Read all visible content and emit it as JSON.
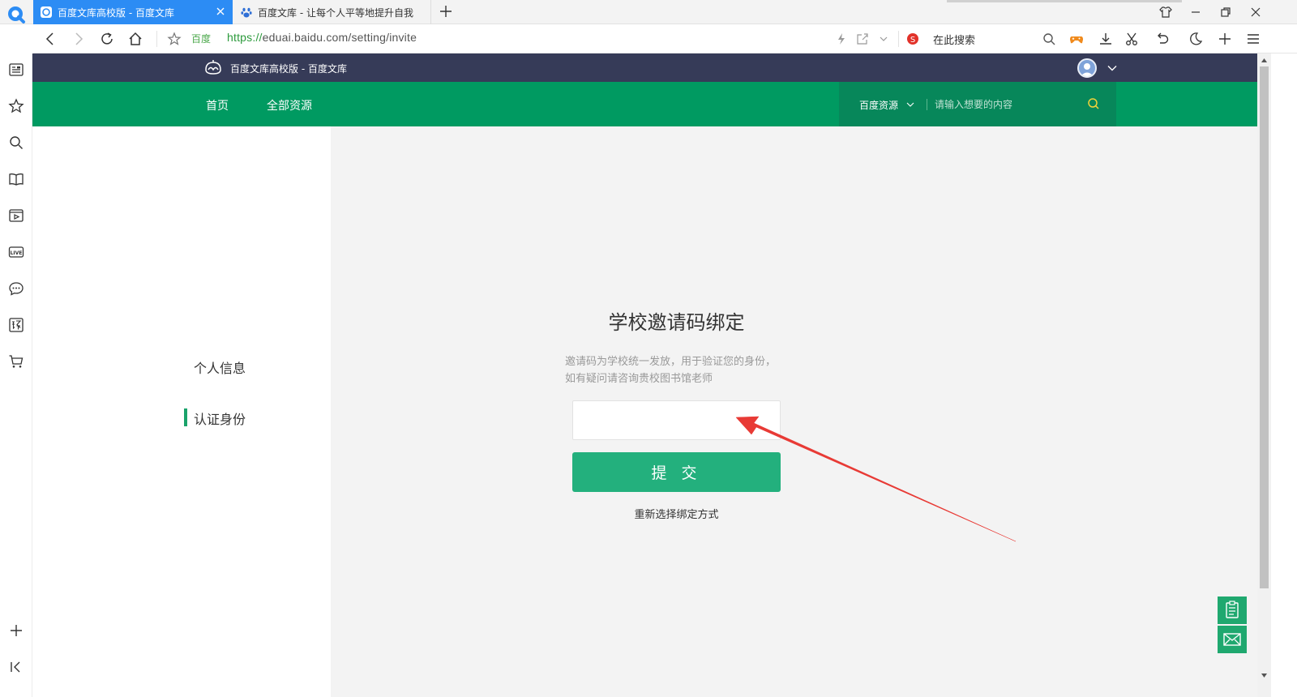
{
  "browser": {
    "tabs": [
      {
        "title": "百度文库高校版 - 百度文库",
        "active": true
      },
      {
        "title": "百度文库 - 让每个人平等地提升自我",
        "active": false
      }
    ],
    "address": {
      "site_name": "百度",
      "url_scheme": "https://",
      "url_rest": "eduai.baidu.com/setting/invite"
    },
    "search_label": "在此搜索",
    "accent": "#2c8cf4"
  },
  "site": {
    "header_title": "百度文库高校版 - 百度文库",
    "nav": [
      {
        "label": "首页"
      },
      {
        "label": "全部资源"
      }
    ],
    "search": {
      "scope_label": "百度资源",
      "placeholder": "请输入想要的内容"
    },
    "colors": {
      "topbar": "#363b58",
      "nav": "#009a61",
      "button": "#23b07d"
    }
  },
  "side_menu": {
    "items": [
      {
        "label": "个人信息",
        "active": false
      },
      {
        "label": "认证身份",
        "active": true
      }
    ]
  },
  "main": {
    "title": "学校邀请码绑定",
    "desc_line1": "邀请码为学校统一发放，用于验证您的身份，",
    "desc_line2": "如有疑问请咨询贵校图书馆老师",
    "input_value": "",
    "submit_label": "提 交",
    "rechoose_label": "重新选择绑定方式"
  }
}
